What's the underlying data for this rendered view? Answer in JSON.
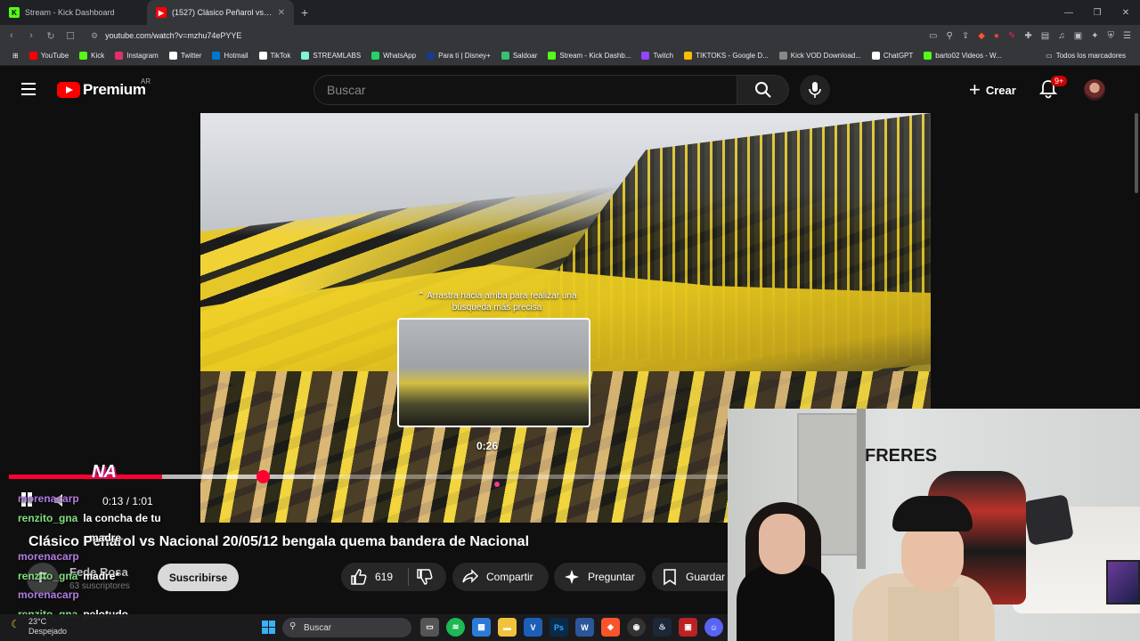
{
  "browser": {
    "tabs": [
      {
        "title": "Stream - Kick Dashboard",
        "icon": "kick-icon",
        "active": false
      },
      {
        "title": "(1527) Clásico Peñarol vs Nacional",
        "icon": "youtube-icon",
        "active": true
      }
    ],
    "url": "youtube.com/watch?v=mzhu74ePYYE",
    "bookmarks": [
      {
        "label": "YouTube",
        "color": "#ff0000"
      },
      {
        "label": "Kick",
        "color": "#53fc18"
      },
      {
        "label": "Instagram",
        "color": "#e1306c"
      },
      {
        "label": "Twitter",
        "color": "#ffffff"
      },
      {
        "label": "Hotmail",
        "color": "#0078d4"
      },
      {
        "label": "TikTok",
        "color": "#ffffff"
      },
      {
        "label": "STREAMLABS",
        "color": "#80f5d2"
      },
      {
        "label": "WhatsApp",
        "color": "#25d366"
      },
      {
        "label": "Para ti | Disney+",
        "color": "#1a3a8a"
      },
      {
        "label": "Saldoar",
        "color": "#38c172"
      },
      {
        "label": "Stream - Kick Dashb...",
        "color": "#53fc18"
      },
      {
        "label": "Twitch",
        "color": "#9146ff"
      },
      {
        "label": "TIKTOKS - Google D...",
        "color": "#fbbc04"
      },
      {
        "label": "Kick VOD Download...",
        "color": "#888888"
      },
      {
        "label": "ChatGPT",
        "color": "#ffffff"
      },
      {
        "label": "barto02 Videos - W...",
        "color": "#53fc18"
      }
    ],
    "all_bookmarks": "Todos los marcadores"
  },
  "youtube": {
    "logo_text": "Premium",
    "country": "AR",
    "search_placeholder": "Buscar",
    "create_label": "Crear",
    "notifications_badge": "9+"
  },
  "player": {
    "hint": "Arrastra hacia arriba para realizar una búsqueda más precisa",
    "preview_time": "0:26",
    "current_time": "0:13",
    "duration": "1:01",
    "time_display": "0:13 / 1:01",
    "progress_fraction": 0.213,
    "hover_fraction": 0.426,
    "accent": "#ff0033"
  },
  "overlay_logo": "NA",
  "video": {
    "title": "Clásico Peñarol vs Nacional 20/05/12 bengala quema bandera de Nacional",
    "channel": "Fede Rosa",
    "subscribers": "63 suscriptores",
    "channel_initial": "F",
    "subscribe_label": "Suscribirse",
    "likes": "619",
    "share_label": "Compartir",
    "ask_label": "Preguntar",
    "save_label": "Guardar"
  },
  "chat": [
    {
      "user": "morenacarp",
      "msg": ""
    },
    {
      "user": "renzito_gna",
      "msg": "la concha de tu"
    },
    {
      "user": "",
      "msg": "madre"
    },
    {
      "user": "morenacarp",
      "msg": ""
    },
    {
      "user": "renzito_gna",
      "msg": "madre*"
    },
    {
      "user": "morenacarp",
      "msg": ""
    },
    {
      "user": "renzito_gna",
      "msg": "pelotudo"
    }
  ],
  "taskbar": {
    "temperature": "23°C",
    "weather": "Despejado",
    "search_label": "Buscar"
  },
  "webcam": {
    "wall_text": "FRERES"
  }
}
